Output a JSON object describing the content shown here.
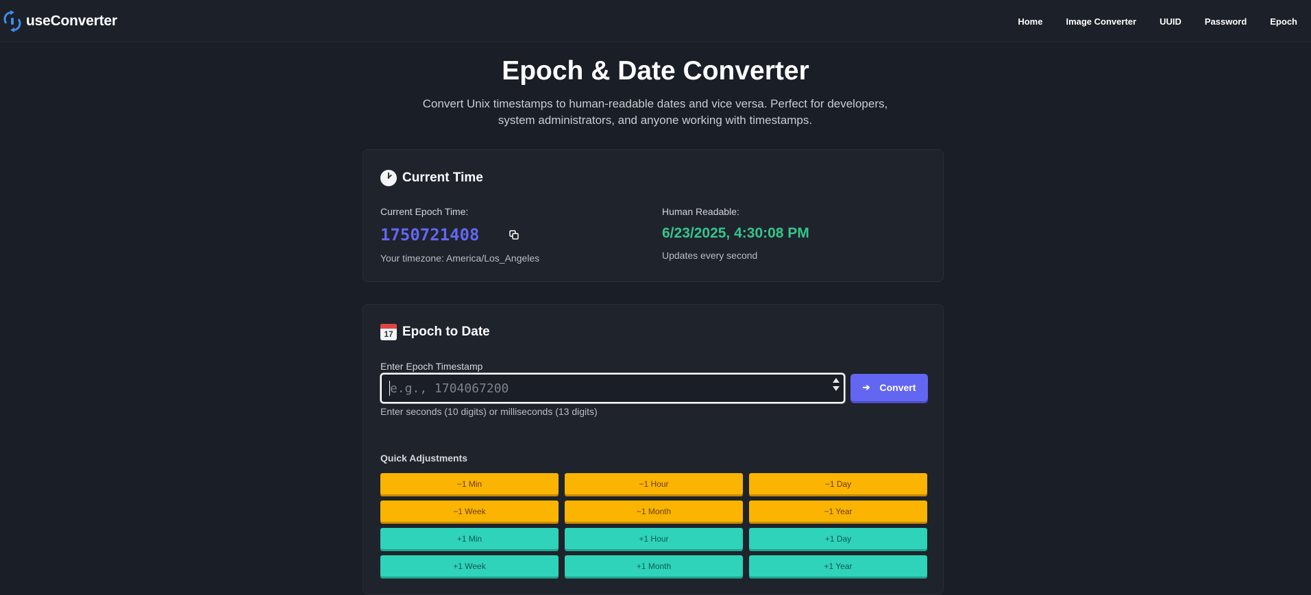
{
  "header": {
    "brand": "useConverter",
    "nav": [
      "Home",
      "Image Converter",
      "UUID",
      "Password",
      "Epoch"
    ]
  },
  "hero": {
    "title": "Epoch & Date Converter",
    "subtitle": "Convert Unix timestamps to human-readable dates and vice versa. Perfect for developers, system administrators, and anyone working with timestamps."
  },
  "current_time": {
    "title": "Current Time",
    "epoch_label": "Current Epoch Time:",
    "epoch_value": "1750721408",
    "timezone": "Your timezone: America/Los_Angeles",
    "human_label": "Human Readable:",
    "human_value": "6/23/2025, 4:30:08 PM",
    "update_note": "Updates every second"
  },
  "epoch_to_date": {
    "title": "Epoch to Date",
    "input_label": "Enter Epoch Timestamp",
    "input_placeholder": "e.g., 1704067200",
    "input_value": "",
    "convert_label": "Convert",
    "hint": "Enter seconds (10 digits) or milliseconds (13 digits)",
    "quick_label": "Quick Adjustments",
    "adjustments": [
      "−1 Min",
      "−1 Hour",
      "−1 Day",
      "−1 Week",
      "−1 Month",
      "−1 Year",
      "+1 Min",
      "+1 Hour",
      "+1 Day",
      "+1 Week",
      "+1 Month",
      "+1 Year"
    ]
  },
  "colors": {
    "accent": "#6366f1",
    "success": "#34c58d",
    "minus": "#fbb500",
    "plus": "#2ed3ba"
  }
}
